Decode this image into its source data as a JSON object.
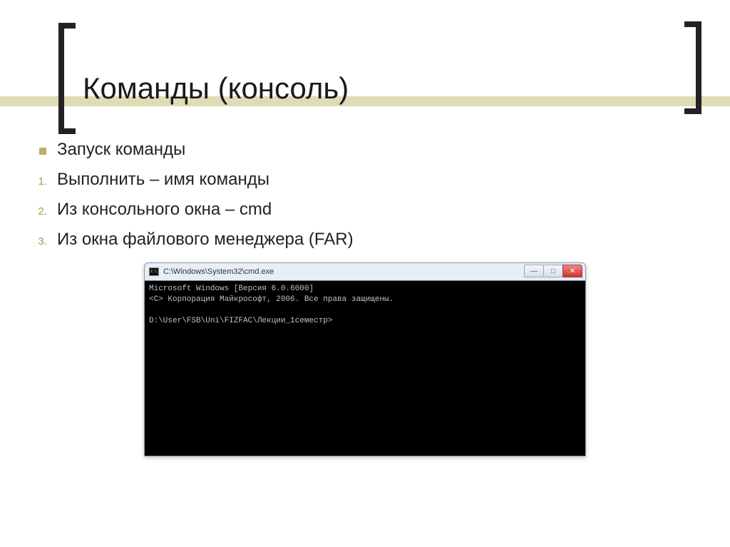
{
  "slide": {
    "title": "Команды (консоль)",
    "bullet": "Запуск команды",
    "items": [
      "Выполнить – имя команды",
      "Из консольного окна – cmd",
      "Из окна файлового менеджера (FAR)"
    ]
  },
  "cmd": {
    "title": "C:\\Windows\\System32\\cmd.exe",
    "line1": "Microsoft Windows [Версия 6.0.6000]",
    "line2": "<C> Корпорация Майкрософт, 2006. Все права защищены.",
    "blank": "",
    "prompt": "D:\\User\\FSB\\Uni\\FIZFAC\\Лекции_1семестр>"
  },
  "controls": {
    "min": "—",
    "max": "□",
    "close": "✕"
  }
}
